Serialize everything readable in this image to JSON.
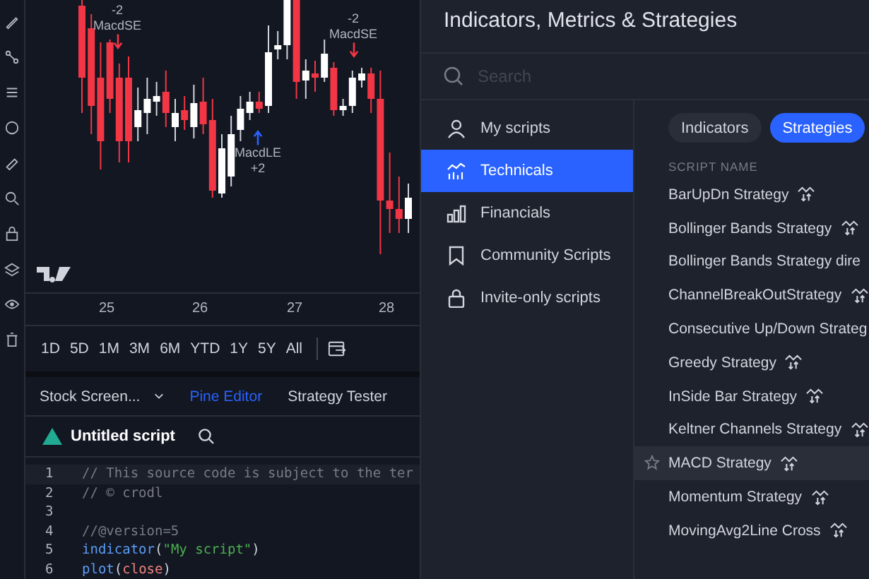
{
  "chart": {
    "signals": [
      {
        "kind": "short",
        "count": "-2",
        "label": "MacdSE"
      },
      {
        "kind": "long",
        "count": "+2",
        "label": "MacdLE"
      },
      {
        "kind": "short",
        "count": "-2",
        "label": "MacdSE"
      }
    ],
    "x_labels": [
      "25",
      "26",
      "27",
      "28"
    ]
  },
  "timeframes": [
    {
      "label": "1D",
      "selected": false
    },
    {
      "label": "5D",
      "selected": false
    },
    {
      "label": "1M",
      "selected": false
    },
    {
      "label": "3M",
      "selected": false
    },
    {
      "label": "6M",
      "selected": false
    },
    {
      "label": "YTD",
      "selected": false
    },
    {
      "label": "1Y",
      "selected": false
    },
    {
      "label": "5Y",
      "selected": false
    },
    {
      "label": "All",
      "selected": false
    }
  ],
  "bottom_tabs": [
    {
      "label": "Stock Screen...",
      "dropdown": true,
      "selected": false
    },
    {
      "label": "Pine Editor",
      "dropdown": false,
      "selected": true
    },
    {
      "label": "Strategy Tester",
      "dropdown": false,
      "selected": false
    }
  ],
  "editor": {
    "script_name": "Untitled script",
    "lines": [
      {
        "number": "1",
        "tokens": [
          {
            "kind": "comment",
            "text": "// This source code is subject to the ter"
          }
        ]
      },
      {
        "number": "2",
        "tokens": [
          {
            "kind": "comment",
            "text": "// © crodl"
          }
        ]
      },
      {
        "number": "3"
      },
      {
        "number": "4",
        "tokens": [
          {
            "kind": "comment",
            "text": "//@version=5"
          }
        ]
      },
      {
        "number": "5",
        "tokens": [
          {
            "kind": "function",
            "text": "indicator"
          },
          {
            "kind": "plain",
            "text": "("
          },
          {
            "kind": "string",
            "text": "\"My script\""
          },
          {
            "kind": "plain",
            "text": ")"
          }
        ]
      },
      {
        "number": "6",
        "tokens": [
          {
            "kind": "function",
            "text": "plot"
          },
          {
            "kind": "plain",
            "text": "("
          },
          {
            "kind": "variable",
            "text": "close"
          },
          {
            "kind": "plain",
            "text": ")"
          }
        ]
      }
    ]
  },
  "dialog": {
    "title": "Indicators, Metrics & Strategies",
    "search": {
      "placeholder": "Search"
    },
    "sidebar": [
      {
        "kind": "person",
        "label": "My scripts",
        "selected": false
      },
      {
        "kind": "technicals",
        "label": "Technicals",
        "selected": true
      },
      {
        "kind": "financials",
        "label": "Financials",
        "selected": false
      },
      {
        "kind": "bookmark",
        "label": "Community Scripts",
        "selected": false
      },
      {
        "kind": "lock",
        "label": "Invite-only scripts",
        "selected": false
      }
    ],
    "filters": [
      {
        "label": "Indicators",
        "selected": false
      },
      {
        "label": "Strategies",
        "selected": true
      }
    ],
    "column_header": "SCRIPT NAME",
    "scripts": [
      {
        "name": "BarUpDn Strategy",
        "icon": true,
        "hovered": false
      },
      {
        "name": "Bollinger Bands Strategy",
        "icon": true,
        "hovered": false
      },
      {
        "name": "Bollinger Bands Strategy dire",
        "icon": false,
        "hovered": false
      },
      {
        "name": "ChannelBreakOutStrategy",
        "icon": true,
        "hovered": false
      },
      {
        "name": "Consecutive Up/Down Strateg",
        "icon": false,
        "hovered": false
      },
      {
        "name": "Greedy Strategy",
        "icon": true,
        "hovered": false
      },
      {
        "name": "InSide Bar Strategy",
        "icon": true,
        "hovered": false
      },
      {
        "name": "Keltner Channels Strategy",
        "icon": true,
        "hovered": false
      },
      {
        "name": "MACD Strategy",
        "icon": true,
        "hovered": true
      },
      {
        "name": "Momentum Strategy",
        "icon": true,
        "hovered": false
      },
      {
        "name": "MovingAvg2Line Cross",
        "icon": true,
        "hovered": false
      }
    ]
  }
}
